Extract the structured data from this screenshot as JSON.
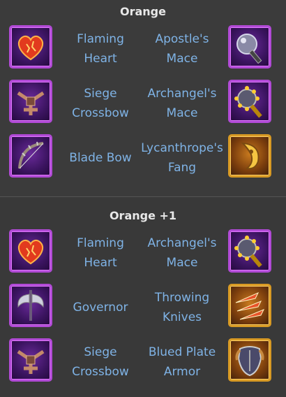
{
  "sections": [
    {
      "title": "Orange",
      "rows": [
        {
          "left": {
            "icon": "flaming-heart-icon",
            "name": "Flaming Heart",
            "line1": "Flaming",
            "line2": "Heart",
            "frame": "purple"
          },
          "right": {
            "icon": "apostles-mace-icon",
            "name": "Apostle's Mace",
            "line1": "Apostle's",
            "line2": "Mace",
            "frame": "purple"
          }
        },
        {
          "left": {
            "icon": "siege-crossbow-icon",
            "name": "Siege Crossbow",
            "line1": "Siege",
            "line2": "Crossbow",
            "frame": "purple"
          },
          "right": {
            "icon": "archangels-mace-icon",
            "name": "Archangel's Mace",
            "line1": "Archangel's",
            "line2": "Mace",
            "frame": "purple"
          }
        },
        {
          "left": {
            "icon": "blade-bow-icon",
            "name": "Blade Bow",
            "line1": "Blade Bow",
            "line2": "",
            "frame": "purple"
          },
          "right": {
            "icon": "lycanthropes-fang-icon",
            "name": "Lycanthrope's Fang",
            "line1": "Lycanthrope's",
            "line2": "Fang",
            "frame": "gold"
          }
        }
      ]
    },
    {
      "title": "Orange +1",
      "rows": [
        {
          "left": {
            "icon": "flaming-heart-icon",
            "name": "Flaming Heart",
            "line1": "Flaming",
            "line2": "Heart",
            "frame": "purple"
          },
          "right": {
            "icon": "archangels-mace-icon",
            "name": "Archangel's Mace",
            "line1": "Archangel's",
            "line2": "Mace",
            "frame": "purple"
          }
        },
        {
          "left": {
            "icon": "governor-icon",
            "name": "Governor",
            "line1": "Governor",
            "line2": "",
            "frame": "purple"
          },
          "right": {
            "icon": "throwing-knives-icon",
            "name": "Throwing Knives",
            "line1": "Throwing",
            "line2": "Knives",
            "frame": "gold"
          }
        },
        {
          "left": {
            "icon": "siege-crossbow-icon",
            "name": "Siege Crossbow",
            "line1": "Siege",
            "line2": "Crossbow",
            "frame": "purple"
          },
          "right": {
            "icon": "blued-plate-armor-icon",
            "name": "Blued Plate Armor",
            "line1": "Blued Plate",
            "line2": "Armor",
            "frame": "gold"
          }
        }
      ]
    }
  ]
}
